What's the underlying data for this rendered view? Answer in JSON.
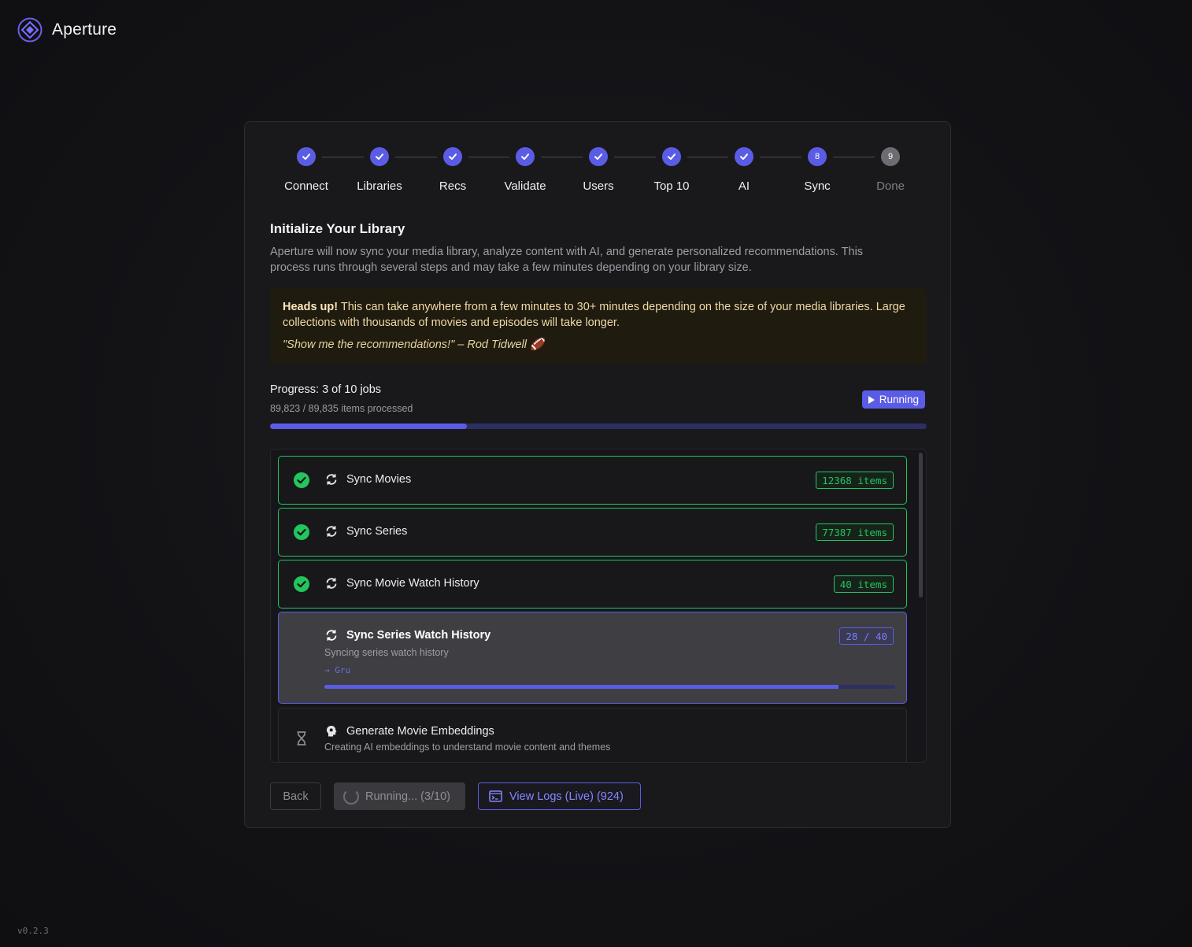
{
  "app": {
    "name": "Aperture",
    "version": "v0.2.3"
  },
  "stepper": {
    "steps": [
      {
        "label": "Connect",
        "state": "complete"
      },
      {
        "label": "Libraries",
        "state": "complete"
      },
      {
        "label": "Recs",
        "state": "complete"
      },
      {
        "label": "Validate",
        "state": "complete"
      },
      {
        "label": "Users",
        "state": "complete"
      },
      {
        "label": "Top 10",
        "state": "complete"
      },
      {
        "label": "AI",
        "state": "complete"
      },
      {
        "label": "Sync",
        "state": "current",
        "number": "8"
      },
      {
        "label": "Done",
        "state": "pending",
        "number": "9"
      }
    ]
  },
  "section": {
    "title": "Initialize Your Library",
    "description": "Aperture will now sync your media library, analyze content with AI, and generate personalized recommendations. This process runs through several steps and may take a few minutes depending on your library size."
  },
  "alert": {
    "heading": "Heads up!",
    "body": " This can take anywhere from a few minutes to 30+ minutes depending on the size of your media libraries. Large collections with thousands of movies and episodes will take longer.",
    "quote": "\"Show me the recommendations!\" – Rod Tidwell 🏈"
  },
  "progress": {
    "title": "Progress: 3 of 10 jobs",
    "items_text": "89,823 / 89,835 items processed",
    "status": "Running",
    "fraction": 0.3
  },
  "jobs": [
    {
      "name": "Sync Movies",
      "state": "done",
      "type_icon": "sync-icon",
      "count": "12368 items"
    },
    {
      "name": "Sync Series",
      "state": "done",
      "type_icon": "sync-icon",
      "count": "77387 items"
    },
    {
      "name": "Sync Movie Watch History",
      "state": "done",
      "type_icon": "sync-icon",
      "count": "40 items"
    },
    {
      "name": "Sync Series Watch History",
      "state": "running",
      "type_icon": "sync-icon",
      "count": "28 / 40",
      "description": "Syncing series watch history",
      "current_item": "→ Gru",
      "fraction": 0.9
    },
    {
      "name": "Generate Movie Embeddings",
      "state": "pending",
      "type_icon": "brain-icon",
      "status_icon": "hourglass-icon",
      "description": "Creating AI embeddings to understand movie content and themes"
    }
  ],
  "buttons": {
    "back": "Back",
    "running": "Running... (3/10)",
    "logs": "View Logs (Live) (924)"
  },
  "colors": {
    "accent": "#5b5ce6",
    "success": "#22c55e",
    "warning_bg": "#1f1b0f",
    "card_bg": "#19191c"
  }
}
